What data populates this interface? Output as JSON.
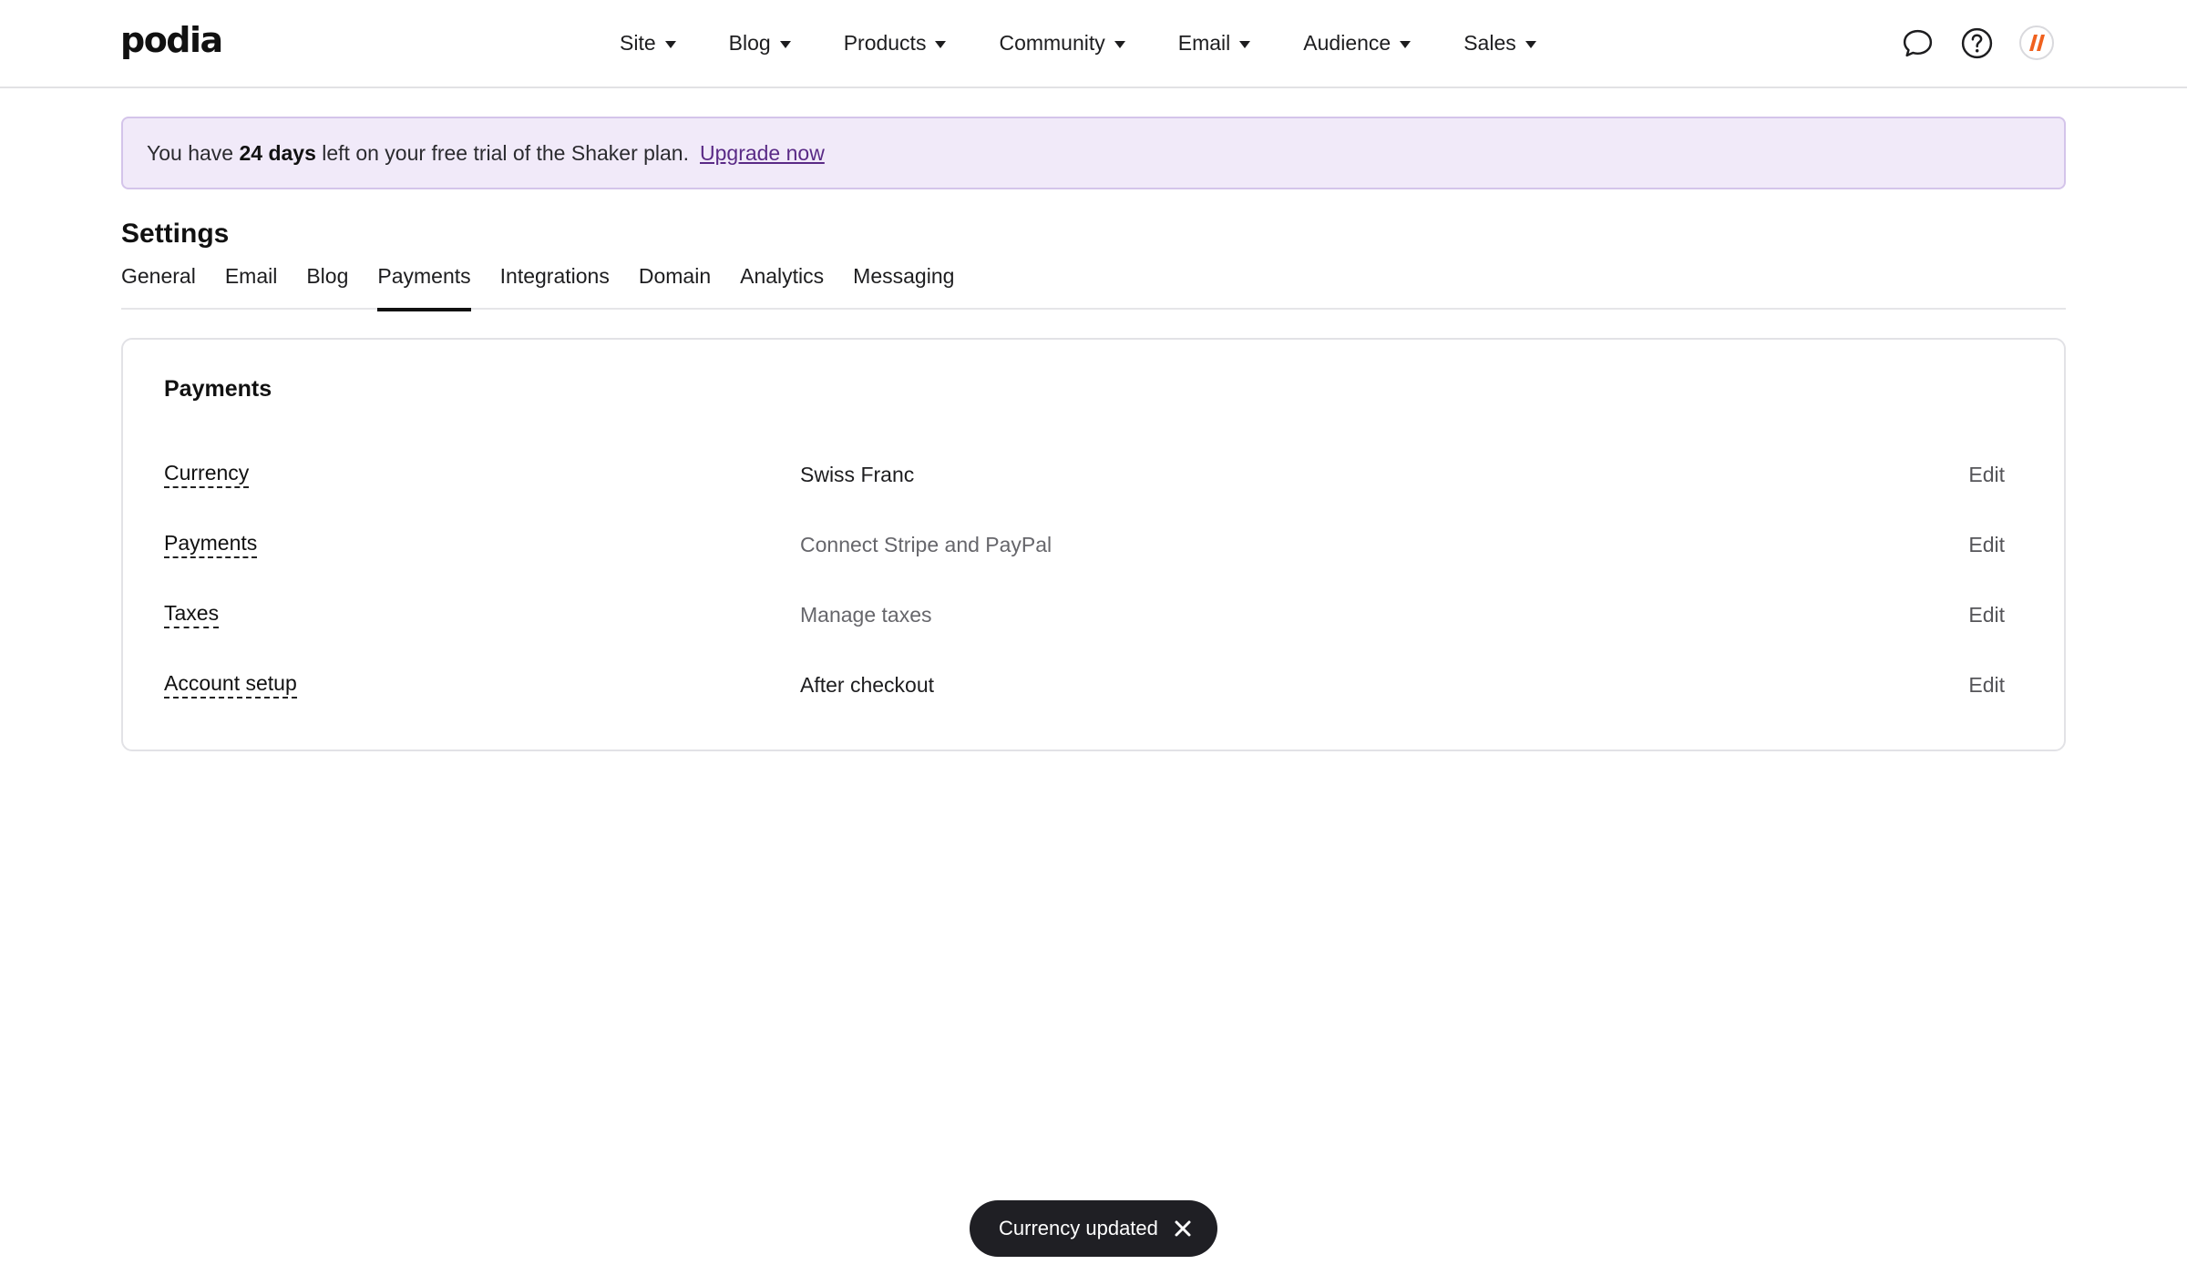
{
  "app": {
    "logo_text": "podia"
  },
  "nav": {
    "items": [
      {
        "label": "Site"
      },
      {
        "label": "Blog"
      },
      {
        "label": "Products"
      },
      {
        "label": "Community"
      },
      {
        "label": "Email"
      },
      {
        "label": "Audience"
      },
      {
        "label": "Sales"
      }
    ],
    "icons": [
      "chat-icon",
      "help-icon",
      "avatar"
    ]
  },
  "banner": {
    "prefix": "You have",
    "days": "24 days",
    "suffix": "left on your free trial of the Shaker plan.",
    "link": "Upgrade now",
    "background": "#f1eaf9",
    "border": "#d4c4ea",
    "link_color": "#5a2a86"
  },
  "settings": {
    "title": "Settings",
    "tabs": [
      {
        "label": "General"
      },
      {
        "label": "Email"
      },
      {
        "label": "Blog"
      },
      {
        "label": "Payments",
        "active": true
      },
      {
        "label": "Integrations"
      },
      {
        "label": "Domain"
      },
      {
        "label": "Analytics"
      },
      {
        "label": "Messaging"
      }
    ]
  },
  "payments": {
    "title": "Payments",
    "rows": [
      {
        "label": "Currency",
        "value": "Swiss Franc",
        "edit": "Edit"
      },
      {
        "label": "Payments",
        "value": "Connect Stripe and PayPal",
        "edit": "Edit"
      },
      {
        "label": "Taxes",
        "value": "Manage taxes",
        "edit": "Edit"
      },
      {
        "label": "Account setup",
        "value": "After checkout",
        "edit": "Edit"
      }
    ]
  },
  "toast": {
    "message": "Currency updated",
    "background": "#1f1f24"
  }
}
